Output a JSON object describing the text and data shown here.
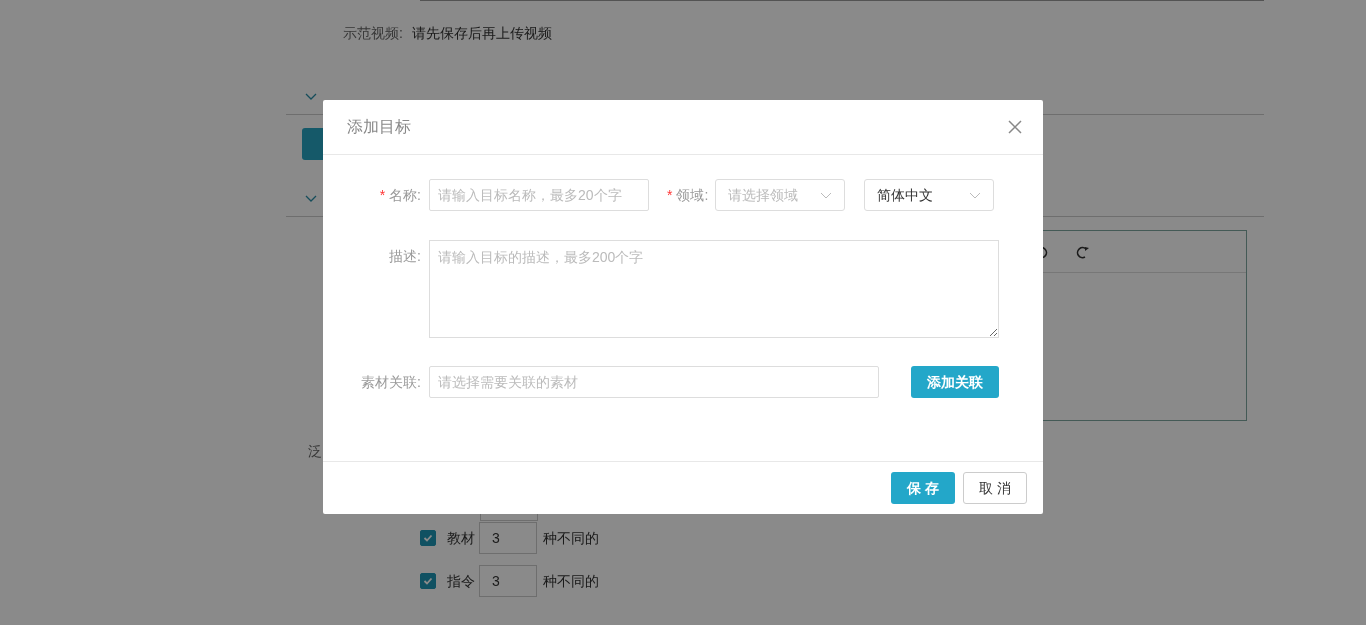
{
  "page": {
    "video_label": "示范视频:",
    "video_value": "请先保存后再上传视频",
    "sections": [
      {
        "expanded": true
      },
      {
        "expanded": true
      }
    ],
    "side_label": "泛",
    "options": [
      {
        "label": "教材",
        "checked": true,
        "value": "3",
        "suffix": "种不同的"
      },
      {
        "label": "指令",
        "checked": true,
        "value": "3",
        "suffix": "种不同的"
      }
    ]
  },
  "dialog": {
    "title": "添加目标",
    "name": {
      "label": "名称:",
      "required_mark": "*",
      "placeholder": "请输入目标名称，最多20个字"
    },
    "domain": {
      "label": "领域:",
      "required_mark": "*",
      "placeholder": "请选择领域"
    },
    "language": {
      "value": "简体中文"
    },
    "description": {
      "label": "描述:",
      "placeholder": "请输入目标的描述，最多200个字"
    },
    "material": {
      "label": "素材关联:",
      "placeholder": "请选择需要关联的素材",
      "button": "添加关联"
    },
    "buttons": [
      {
        "label": "保 存",
        "kind": "primary"
      },
      {
        "label": "取 消",
        "kind": "secondary"
      }
    ]
  }
}
